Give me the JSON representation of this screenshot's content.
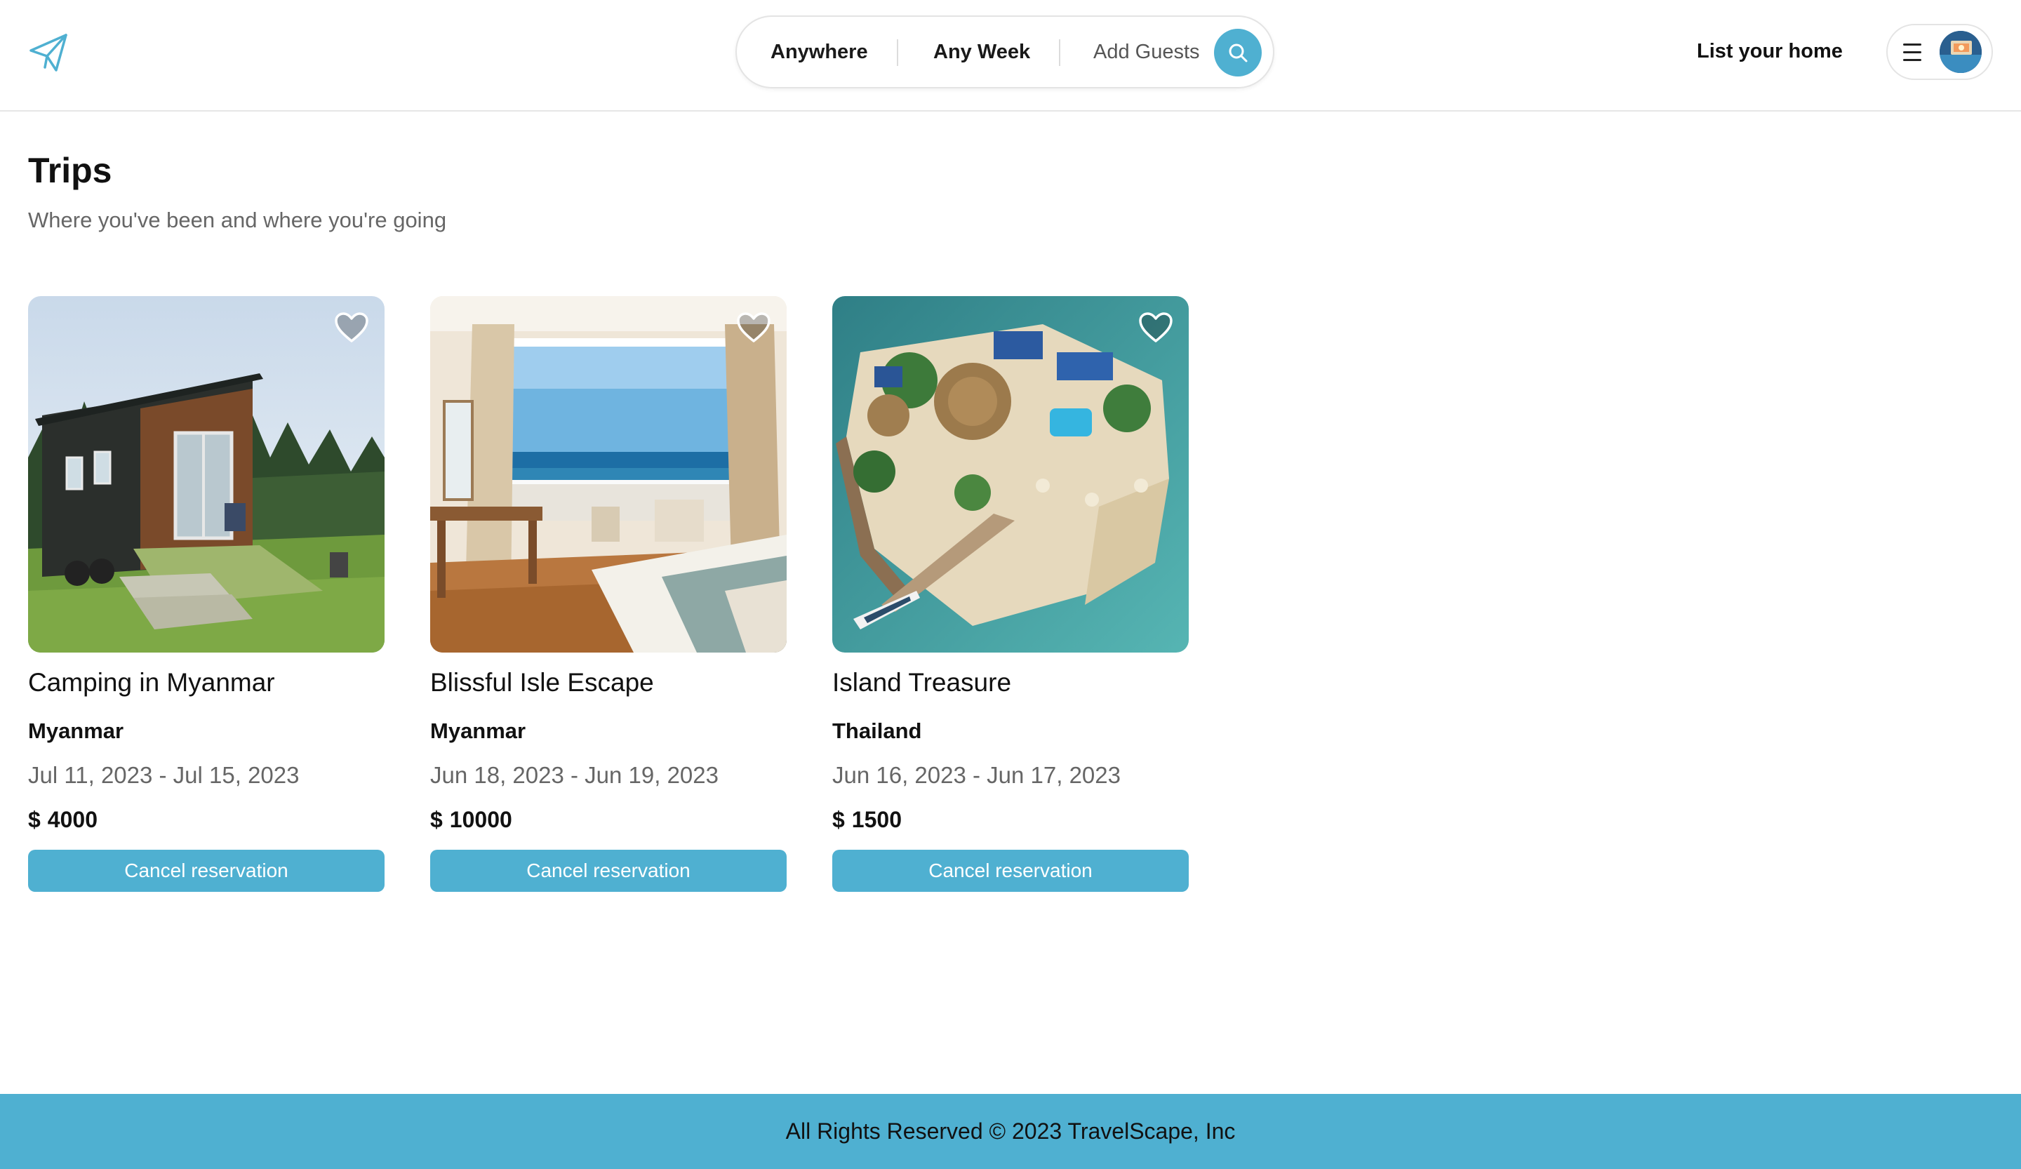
{
  "header": {
    "logo_icon": "paper-plane-icon",
    "search": {
      "where": "Anywhere",
      "when": "Any Week",
      "guests": "Add Guests",
      "search_icon": "search-icon"
    },
    "list_home_label": "List your home",
    "menu_icon": "hamburger-menu-icon"
  },
  "page": {
    "title": "Trips",
    "subtitle": "Where you've been and where you're going"
  },
  "trips": [
    {
      "title": "Camping in Myanmar",
      "location": "Myanmar",
      "dates": "Jul 11, 2023 - Jul 15, 2023",
      "currency": "$",
      "price": "4000",
      "cancel_label": "Cancel reservation",
      "image": "tiny-house-in-forest",
      "favorited": false
    },
    {
      "title": "Blissful Isle Escape",
      "location": "Myanmar",
      "dates": "Jun 18, 2023 - Jun 19, 2023",
      "currency": "$",
      "price": "10000",
      "cancel_label": "Cancel reservation",
      "image": "hotel-room-ocean-view",
      "favorited": false
    },
    {
      "title": "Island Treasure",
      "location": "Thailand",
      "dates": "Jun 16, 2023 - Jun 17, 2023",
      "currency": "$",
      "price": "1500",
      "cancel_label": "Cancel reservation",
      "image": "private-island-aerial",
      "favorited": false
    }
  ],
  "footer": {
    "text": "All Rights Reserved © 2023 TravelScape, Inc"
  },
  "colors": {
    "accent": "#4fb0d1",
    "text": "#111111",
    "muted": "#666666",
    "border": "#e4e4e4"
  }
}
